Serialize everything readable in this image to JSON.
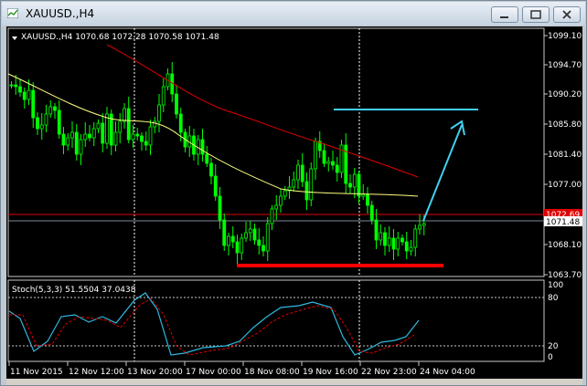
{
  "window": {
    "title": "XAUUSD.,H4"
  },
  "chart": {
    "header": "XAUUSD.,H4  1070.68 1072.28 1070.58 1071.48",
    "price_ticks": [
      "1099.10",
      "1094.70",
      "1090.20",
      "1085.80",
      "1081.40",
      "1077.00",
      "1072.69",
      "1071.48",
      "1068.10",
      "1063.70"
    ],
    "current_price_label": "1071.48",
    "red_level_label": "1072.69",
    "time_ticks": [
      "11 Nov 2015",
      "12 Nov 12:00",
      "13 Nov 20:00",
      "17 Nov 00:00",
      "18 Nov 08:00",
      "19 Nov 16:00",
      "22 Nov 23:00",
      "24 Nov 04:00"
    ],
    "stoch_header": "Stoch(5,3,3) 51.5504 37.0438",
    "stoch_ticks": [
      "100",
      "80",
      "20",
      "0"
    ],
    "colors": {
      "background": "#000000",
      "up": "#00ff00",
      "down": "#00ff00",
      "ma_fast": "#ffff80",
      "ma_slow": "#e00000",
      "support": "#ff0000",
      "target": "#40d0f0",
      "stoch_main": "#30b8e0",
      "stoch_signal": "#e00000"
    }
  }
}
